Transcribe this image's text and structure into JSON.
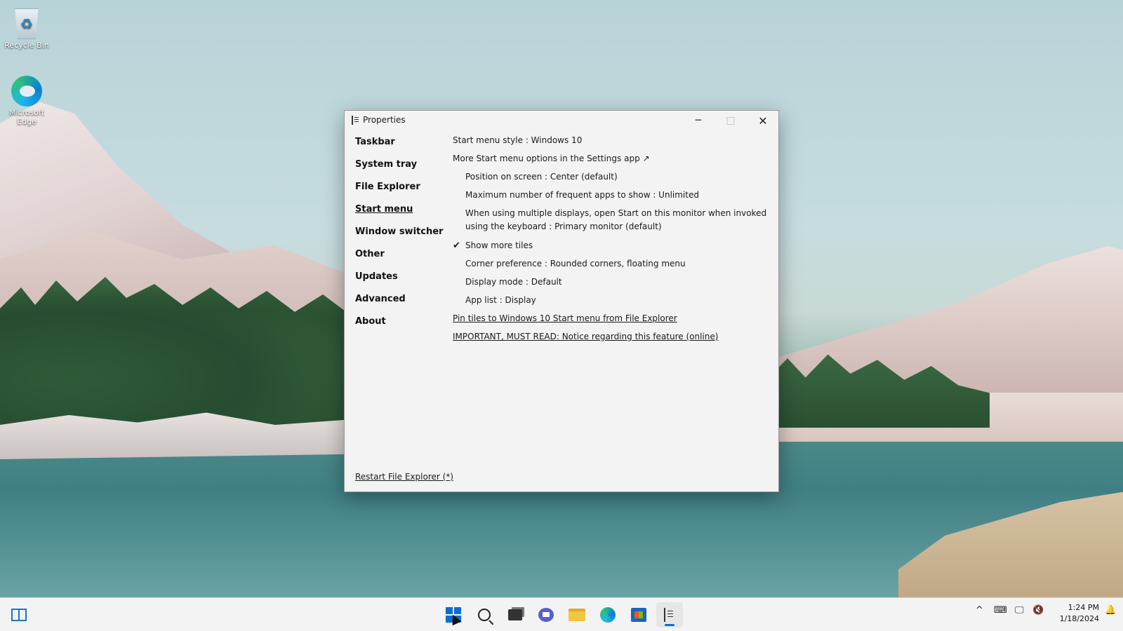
{
  "desktop": {
    "icons": [
      {
        "label": "Recycle Bin",
        "icon": "recycle-bin-icon"
      },
      {
        "label": "Microsoft Edge",
        "icon": "edge-icon"
      }
    ]
  },
  "window": {
    "title": "Properties",
    "controls": {
      "minimize": "─",
      "maximize": "□",
      "close": "✕"
    },
    "nav": [
      {
        "label": "Taskbar"
      },
      {
        "label": "System tray"
      },
      {
        "label": "File Explorer"
      },
      {
        "label": "Start menu",
        "active": true
      },
      {
        "label": "Window switcher"
      },
      {
        "label": "Other"
      },
      {
        "label": "Updates"
      },
      {
        "label": "Advanced"
      },
      {
        "label": "About"
      }
    ],
    "options": {
      "style": "Start menu style : Windows 10",
      "more_options": "More Start menu options in the Settings app ↗",
      "position": "Position on screen : Center (default)",
      "max_frequent": "Maximum number of frequent apps to show : Unlimited",
      "multi_display": "When using multiple displays, open Start on this monitor when invoked using the keyboard : Primary monitor (default)",
      "show_more_tiles": "Show more tiles",
      "checkmark": "✔",
      "corner_preference": "Corner preference : Rounded corners, floating menu",
      "display_mode": "Display mode : Default",
      "app_list": "App list : Display",
      "pin_tiles_link": "Pin tiles to Windows 10 Start menu from File Explorer",
      "important_link": "IMPORTANT, MUST READ: Notice regarding this feature (online)"
    },
    "restart_link": "Restart File Explorer (*)"
  },
  "taskbar": {
    "clock_time": "1:24 PM",
    "clock_date": "1/18/2024",
    "tray_chevron": "^",
    "tray_keyboard": "⌨",
    "tray_network": "🖵",
    "tray_volume": "🔇",
    "tray_notify": "🔔",
    "accent": "#0a6fd1"
  }
}
